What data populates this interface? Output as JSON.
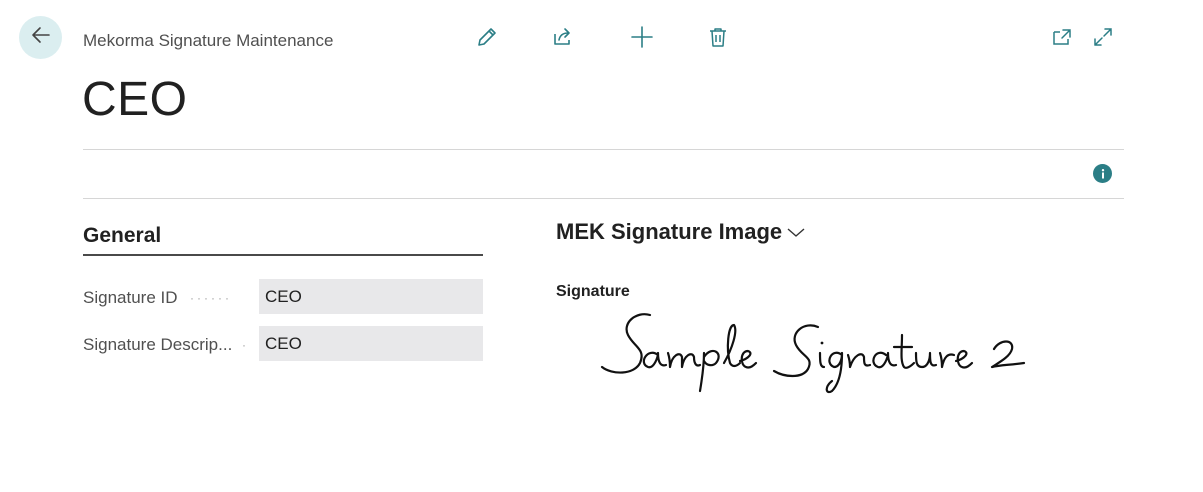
{
  "header": {
    "page_caption": "Mekorma Signature Maintenance",
    "record_title": "CEO",
    "icons": {
      "back": "arrow-left-icon",
      "edit": "pencil-icon",
      "share": "share-icon",
      "new": "plus-icon",
      "delete": "trash-icon",
      "open_new_window": "open-in-new-window-icon",
      "expand": "expand-icon",
      "info": "info-icon"
    }
  },
  "general": {
    "title": "General",
    "fields": [
      {
        "label": "Signature ID",
        "value": "CEO"
      },
      {
        "label": "Signature Descrip...",
        "value": "CEO"
      }
    ]
  },
  "signature_image": {
    "title": "MEK Signature Image",
    "field_label": "Signature",
    "image_text": "Sample Signature 2"
  },
  "colors": {
    "accent": "#2b7e86",
    "back_button_bg": "#dbeef0",
    "field_bg": "#e8e8ea",
    "divider": "#d6d6d6"
  }
}
